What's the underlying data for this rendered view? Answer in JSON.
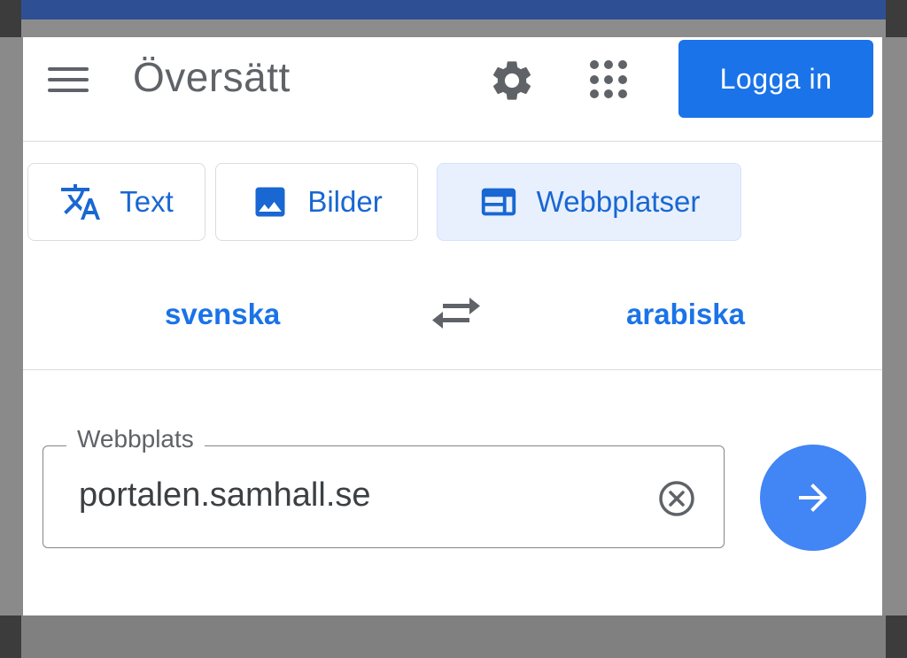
{
  "header": {
    "app_title": "Översätt",
    "login_label": "Logga in"
  },
  "tabs": [
    {
      "label": "Text",
      "icon": "translate-icon",
      "active": false
    },
    {
      "label": "Bilder",
      "icon": "image-icon",
      "active": false
    },
    {
      "label": "Webbplatser",
      "icon": "web-icon",
      "active": true
    }
  ],
  "languages": {
    "source": "svenska",
    "target": "arabiska"
  },
  "website": {
    "label": "Webbplats",
    "value": "portalen.samhall.se"
  },
  "colors": {
    "accent": "#1a73e8",
    "tab_text": "#1967d2",
    "active_tab_bg": "#e8f0fe",
    "go_button": "#4285f4",
    "icon_gray": "#5f6368"
  }
}
